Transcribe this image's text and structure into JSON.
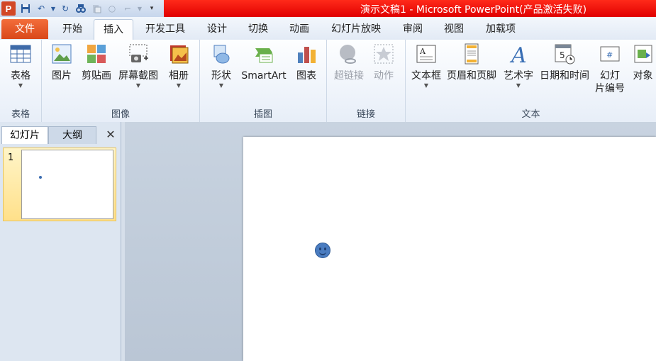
{
  "window": {
    "title": "演示文稿1 - Microsoft PowerPoint(产品激活失败)",
    "app_icon": "P"
  },
  "tabs": [
    "文件",
    "开始",
    "插入",
    "开发工具",
    "设计",
    "切换",
    "动画",
    "幻灯片放映",
    "审阅",
    "视图",
    "加载项"
  ],
  "ribbon": {
    "groups": {
      "table": "表格",
      "images": "图像",
      "illustrations": "插图",
      "links": "链接",
      "text": "文本"
    },
    "buttons": {
      "table": "表格",
      "picture": "图片",
      "clipart": "剪贴画",
      "screenshot": "屏幕截图",
      "album": "相册",
      "shapes": "形状",
      "smartart": "SmartArt",
      "chart": "图表",
      "hyperlink": "超链接",
      "action": "动作",
      "textbox": "文本框",
      "header_footer": "页眉和页脚",
      "wordart": "艺术字",
      "datetime": "日期和时间",
      "slide_number_1": "幻灯",
      "slide_number_2": "片编号",
      "object": "对象"
    }
  },
  "left_pane": {
    "tab_slides": "幻灯片",
    "tab_outline": "大纲",
    "close": "✕",
    "slide_number": "1"
  },
  "colors": {
    "title_bar": "#e00000",
    "file_tab": "#d9481a",
    "thumb_selected": "#ffe08a"
  }
}
